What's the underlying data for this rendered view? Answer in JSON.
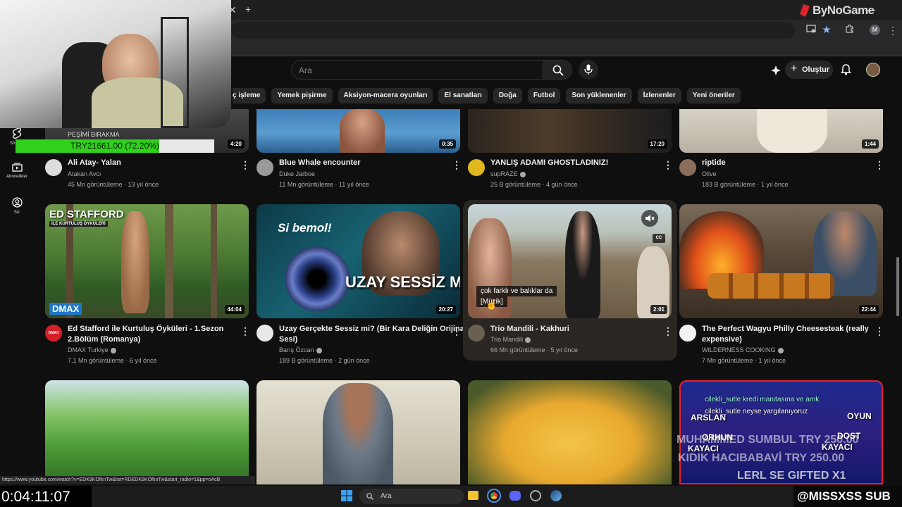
{
  "browser": {
    "brand_watermark": "ByNoGame",
    "profile_initial": "M"
  },
  "header": {
    "search_placeholder": "Ara",
    "create_label": "Oluştur"
  },
  "chips": [
    "ç işleme",
    "Yemek pişirme",
    "Aksiyon-macera oyunları",
    "El sanatları",
    "Doğa",
    "Futbol",
    "Son yüklenenler",
    "İzlenenler",
    "Yeni öneriler"
  ],
  "sidebar": {
    "shorts_label": "Sh",
    "subscriptions_label": "Abonelikler",
    "you_label": "Siz"
  },
  "row1": [
    {
      "title": "Ali Atay- Yalan",
      "channel": "Atakan Avcı",
      "meta": "45 Mn görüntüleme · 13 yıl önce",
      "duration": "4:20"
    },
    {
      "title": "Blue Whale encounter",
      "channel": "Duke Jarboe",
      "meta": "11 Mn görüntüleme · 11 yıl önce",
      "duration": "0:35"
    },
    {
      "title": "YANLIŞ ADAMI GHOSTLADINIZ!",
      "channel": "supRAZE",
      "meta": "25 B görüntüleme · 4 gün önce",
      "duration": "17:20"
    },
    {
      "title": "riptide",
      "channel": "Olive",
      "meta": "183 B görüntüleme · 1 yıl önce",
      "duration": "1:44"
    }
  ],
  "row2": [
    {
      "title": "Ed Stafford ile Kurtuluş Öyküleri - 1.Sezon",
      "title2": "2.Bölüm (Romanya)",
      "channel": "DMAX Turkiye",
      "meta": "7,1 Mn görüntüleme · 6 yıl önce",
      "duration": "44:04",
      "thumb_text": "ED STAFFORD",
      "thumb_sub": "İLE KURTULUŞ ÖYKÜLERİ",
      "thumb_logo": "DMAX",
      "avatar_text": "DMAX"
    },
    {
      "title": "Uzay Gerçekte Sessiz mi? (Bir Kara Deliğin Orijinal",
      "title2": "Sesi)",
      "channel": "Barış Özcan",
      "meta": "189 B görüntüleme · 2 gün önce",
      "duration": "20:27",
      "thumb_text": "Si bemol!",
      "thumb_sub": "UZAY SESSİZ Mİ?"
    },
    {
      "title": "Trio Mandili - Kakhuri",
      "title2": "",
      "channel": "Trio Mandili",
      "meta": "66 Mn görüntüleme · 5 yıl önce",
      "duration": "2:01",
      "caption1": "çok farklı ve balıklar da",
      "caption2": "[Müzik]",
      "cc": "CC"
    },
    {
      "title": "The Perfect Wagyu Philly Cheesesteak (really",
      "title2": "expensive)",
      "channel": "WILDERNESS COOKING",
      "meta": "7 Mn görüntüleme · 1 yıl önce",
      "duration": "22:44"
    }
  ],
  "overlay": {
    "donation_caption": "PEŞİMİ BIRAKMA",
    "donation_text": "TRY21661.00 (72.20%)",
    "donation_progress": 0.722,
    "timer": "0:04:11:07",
    "status_url": "https://www.youtube.com/watch?v=EDK9KOfknTw&list=RDEDK9KOfknTw&start_radio=1&pp=oAcB",
    "taskbar_search": "Ara",
    "sub_tag": "@MISSXSS SUB",
    "ticker1": "MUHAMMED SUMBUL TRY 250.00",
    "ticker2": "KIDIK HACIBABAVİ TRY 250.00",
    "ticker3": "LERL SE GIFTED X1",
    "chat1_user": "cilekli_sutle",
    "chat1": "cilekli_sutle kredi manitasına ve amk",
    "chat2": "cilekli_sutle neyse yargılanıyoruz",
    "thumb4_names": [
      "ARSLAN",
      "ORHUN",
      "KAYACI",
      "OYUN",
      "DOST",
      "KAYACI"
    ]
  }
}
